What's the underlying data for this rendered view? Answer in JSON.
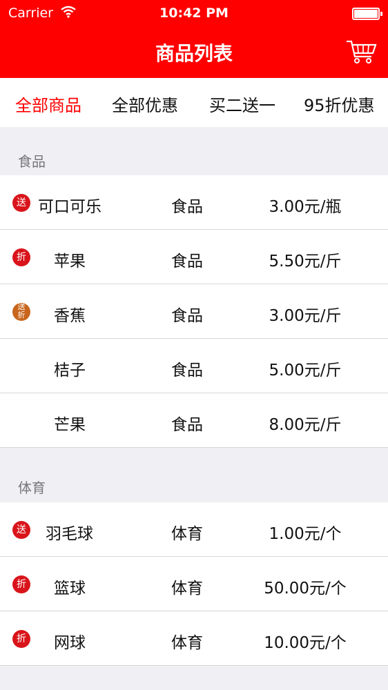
{
  "status_bar": {
    "carrier": "Carrier",
    "time": "10:42 PM"
  },
  "nav": {
    "title": "商品列表",
    "cart_icon": "shopping-cart-icon"
  },
  "tabs": [
    {
      "label": "全部商品",
      "active": true
    },
    {
      "label": "全部优惠",
      "active": false
    },
    {
      "label": "买二送一",
      "active": false
    },
    {
      "label": "95折优惠",
      "active": false
    }
  ],
  "sections": [
    {
      "title": "食品",
      "items": [
        {
          "badge": "送",
          "name": "可口可乐",
          "category": "食品",
          "price": "3.00元/瓶"
        },
        {
          "badge": "折",
          "name": "苹果",
          "category": "食品",
          "price": "5.50元/斤"
        },
        {
          "badge": "送折",
          "name": "香蕉",
          "category": "食品",
          "price": "3.00元/斤"
        },
        {
          "badge": "",
          "name": "桔子",
          "category": "食品",
          "price": "5.00元/斤"
        },
        {
          "badge": "",
          "name": "芒果",
          "category": "食品",
          "price": "8.00元/斤"
        }
      ]
    },
    {
      "title": "体育",
      "items": [
        {
          "badge": "送",
          "name": "羽毛球",
          "category": "体育",
          "price": "1.00元/个"
        },
        {
          "badge": "折",
          "name": "篮球",
          "category": "体育",
          "price": "50.00元/个"
        },
        {
          "badge": "折",
          "name": "网球",
          "category": "体育",
          "price": "10.00元/个"
        }
      ]
    }
  ],
  "colors": {
    "accent": "#ff0000",
    "background": "#efeff4",
    "badge_red": "#d9141b",
    "badge_orange": "#c8651c"
  }
}
